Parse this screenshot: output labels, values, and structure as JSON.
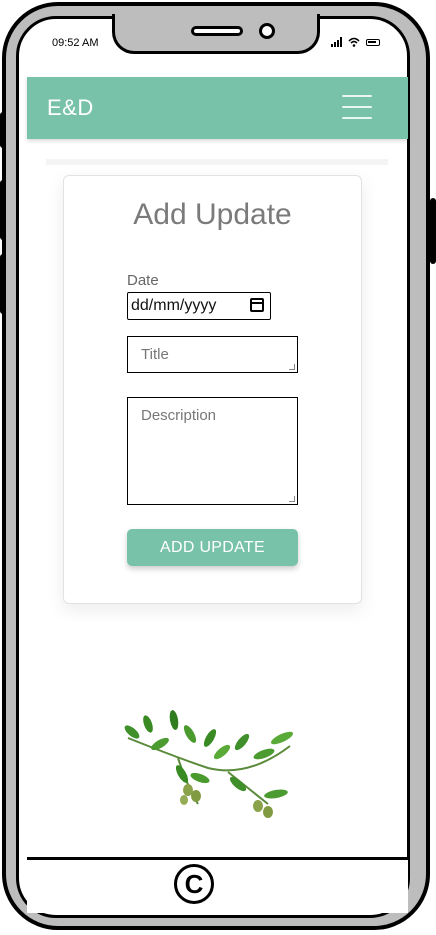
{
  "status_bar": {
    "time": "09:52 AM"
  },
  "header": {
    "brand": "E&D",
    "menu_icon": "hamburger-menu-icon"
  },
  "form": {
    "title": "Add Update",
    "date_label": "Date",
    "date_placeholder": "dd/mm/yyyy",
    "title_placeholder": "Title",
    "description_placeholder": "Description",
    "submit_label": "ADD UPDATE"
  },
  "footer": {
    "symbol": "C"
  },
  "colors": {
    "accent": "#79c2aa",
    "title_text": "#7a7a7a"
  },
  "decor": {
    "image": "olive-branch-illustration"
  }
}
